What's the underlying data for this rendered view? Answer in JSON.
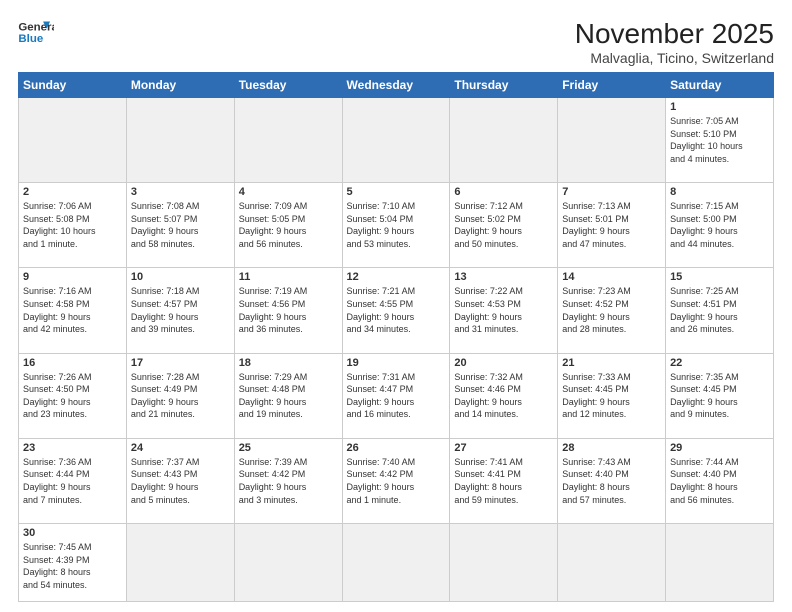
{
  "header": {
    "logo_line1": "General",
    "logo_line2": "Blue",
    "title": "November 2025",
    "subtitle": "Malvaglia, Ticino, Switzerland"
  },
  "days_of_week": [
    "Sunday",
    "Monday",
    "Tuesday",
    "Wednesday",
    "Thursday",
    "Friday",
    "Saturday"
  ],
  "weeks": [
    [
      {
        "day": "",
        "info": "",
        "empty": true
      },
      {
        "day": "",
        "info": "",
        "empty": true
      },
      {
        "day": "",
        "info": "",
        "empty": true
      },
      {
        "day": "",
        "info": "",
        "empty": true
      },
      {
        "day": "",
        "info": "",
        "empty": true
      },
      {
        "day": "",
        "info": "",
        "empty": true
      },
      {
        "day": "1",
        "info": "Sunrise: 7:05 AM\nSunset: 5:10 PM\nDaylight: 10 hours\nand 4 minutes."
      }
    ],
    [
      {
        "day": "2",
        "info": "Sunrise: 7:06 AM\nSunset: 5:08 PM\nDaylight: 10 hours\nand 1 minute."
      },
      {
        "day": "3",
        "info": "Sunrise: 7:08 AM\nSunset: 5:07 PM\nDaylight: 9 hours\nand 58 minutes."
      },
      {
        "day": "4",
        "info": "Sunrise: 7:09 AM\nSunset: 5:05 PM\nDaylight: 9 hours\nand 56 minutes."
      },
      {
        "day": "5",
        "info": "Sunrise: 7:10 AM\nSunset: 5:04 PM\nDaylight: 9 hours\nand 53 minutes."
      },
      {
        "day": "6",
        "info": "Sunrise: 7:12 AM\nSunset: 5:02 PM\nDaylight: 9 hours\nand 50 minutes."
      },
      {
        "day": "7",
        "info": "Sunrise: 7:13 AM\nSunset: 5:01 PM\nDaylight: 9 hours\nand 47 minutes."
      },
      {
        "day": "8",
        "info": "Sunrise: 7:15 AM\nSunset: 5:00 PM\nDaylight: 9 hours\nand 44 minutes."
      }
    ],
    [
      {
        "day": "9",
        "info": "Sunrise: 7:16 AM\nSunset: 4:58 PM\nDaylight: 9 hours\nand 42 minutes."
      },
      {
        "day": "10",
        "info": "Sunrise: 7:18 AM\nSunset: 4:57 PM\nDaylight: 9 hours\nand 39 minutes."
      },
      {
        "day": "11",
        "info": "Sunrise: 7:19 AM\nSunset: 4:56 PM\nDaylight: 9 hours\nand 36 minutes."
      },
      {
        "day": "12",
        "info": "Sunrise: 7:21 AM\nSunset: 4:55 PM\nDaylight: 9 hours\nand 34 minutes."
      },
      {
        "day": "13",
        "info": "Sunrise: 7:22 AM\nSunset: 4:53 PM\nDaylight: 9 hours\nand 31 minutes."
      },
      {
        "day": "14",
        "info": "Sunrise: 7:23 AM\nSunset: 4:52 PM\nDaylight: 9 hours\nand 28 minutes."
      },
      {
        "day": "15",
        "info": "Sunrise: 7:25 AM\nSunset: 4:51 PM\nDaylight: 9 hours\nand 26 minutes."
      }
    ],
    [
      {
        "day": "16",
        "info": "Sunrise: 7:26 AM\nSunset: 4:50 PM\nDaylight: 9 hours\nand 23 minutes."
      },
      {
        "day": "17",
        "info": "Sunrise: 7:28 AM\nSunset: 4:49 PM\nDaylight: 9 hours\nand 21 minutes."
      },
      {
        "day": "18",
        "info": "Sunrise: 7:29 AM\nSunset: 4:48 PM\nDaylight: 9 hours\nand 19 minutes."
      },
      {
        "day": "19",
        "info": "Sunrise: 7:31 AM\nSunset: 4:47 PM\nDaylight: 9 hours\nand 16 minutes."
      },
      {
        "day": "20",
        "info": "Sunrise: 7:32 AM\nSunset: 4:46 PM\nDaylight: 9 hours\nand 14 minutes."
      },
      {
        "day": "21",
        "info": "Sunrise: 7:33 AM\nSunset: 4:45 PM\nDaylight: 9 hours\nand 12 minutes."
      },
      {
        "day": "22",
        "info": "Sunrise: 7:35 AM\nSunset: 4:45 PM\nDaylight: 9 hours\nand 9 minutes."
      }
    ],
    [
      {
        "day": "23",
        "info": "Sunrise: 7:36 AM\nSunset: 4:44 PM\nDaylight: 9 hours\nand 7 minutes."
      },
      {
        "day": "24",
        "info": "Sunrise: 7:37 AM\nSunset: 4:43 PM\nDaylight: 9 hours\nand 5 minutes."
      },
      {
        "day": "25",
        "info": "Sunrise: 7:39 AM\nSunset: 4:42 PM\nDaylight: 9 hours\nand 3 minutes."
      },
      {
        "day": "26",
        "info": "Sunrise: 7:40 AM\nSunset: 4:42 PM\nDaylight: 9 hours\nand 1 minute."
      },
      {
        "day": "27",
        "info": "Sunrise: 7:41 AM\nSunset: 4:41 PM\nDaylight: 8 hours\nand 59 minutes."
      },
      {
        "day": "28",
        "info": "Sunrise: 7:43 AM\nSunset: 4:40 PM\nDaylight: 8 hours\nand 57 minutes."
      },
      {
        "day": "29",
        "info": "Sunrise: 7:44 AM\nSunset: 4:40 PM\nDaylight: 8 hours\nand 56 minutes."
      }
    ],
    [
      {
        "day": "30",
        "info": "Sunrise: 7:45 AM\nSunset: 4:39 PM\nDaylight: 8 hours\nand 54 minutes.",
        "last": true
      },
      {
        "day": "",
        "info": "",
        "empty": true,
        "last": true
      },
      {
        "day": "",
        "info": "",
        "empty": true,
        "last": true
      },
      {
        "day": "",
        "info": "",
        "empty": true,
        "last": true
      },
      {
        "day": "",
        "info": "",
        "empty": true,
        "last": true
      },
      {
        "day": "",
        "info": "",
        "empty": true,
        "last": true
      },
      {
        "day": "",
        "info": "",
        "empty": true,
        "last": true
      }
    ]
  ]
}
